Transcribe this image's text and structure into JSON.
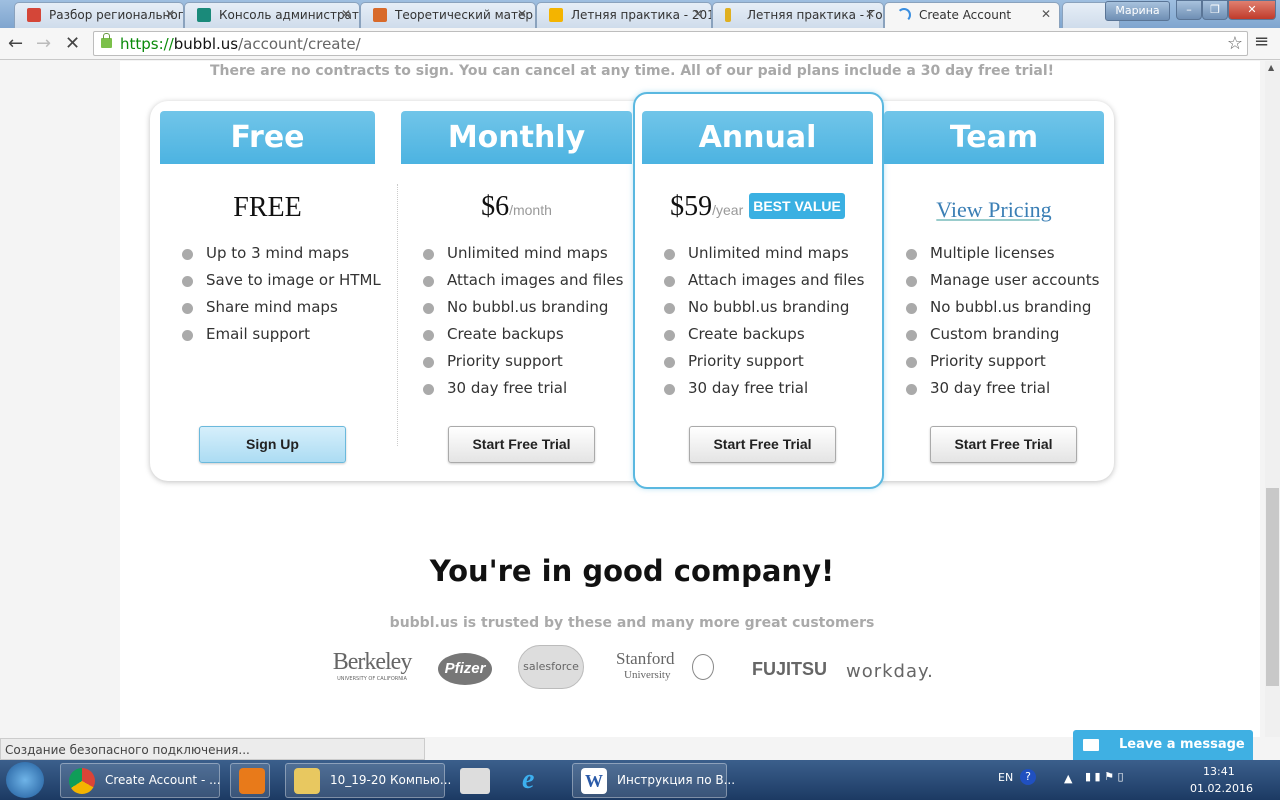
{
  "browser": {
    "tabs": [
      {
        "title": "Разбор региональног",
        "icon": "gmail-icon",
        "color": "#d44638"
      },
      {
        "title": "Консоль администрат",
        "icon": "console-icon",
        "color": "#1a8a7a"
      },
      {
        "title": "Теоретический матер",
        "icon": "owl-icon",
        "color": "#d86a2a"
      },
      {
        "title": "Летняя практика - 201",
        "icon": "google-drive-icon",
        "color": "#f4b400"
      },
      {
        "title": "Летняя практика - Гор",
        "icon": "site-icon",
        "color": "#e0b020"
      },
      {
        "title": "Create Account",
        "icon": "loading-icon",
        "color": "#3a8ee0"
      }
    ],
    "user": "Марина",
    "url_scheme": "https://",
    "url_host": "bubbl.us",
    "url_path": "/account/create/",
    "status": "Создание безопасного подключения..."
  },
  "page": {
    "top_note": "There are no contracts to sign. You can cancel at any time. All of our paid plans include a 30 day free trial!",
    "plans": [
      {
        "name": "Free",
        "price": "FREE",
        "features": [
          "Up to 3 mind maps",
          "Save to image or HTML",
          "Share mind maps",
          "Email support"
        ],
        "button": "Sign Up"
      },
      {
        "name": "Monthly",
        "price": "$6",
        "period": "/month",
        "features": [
          "Unlimited mind maps",
          "Attach images and files",
          "No bubbl.us branding",
          "Create backups",
          "Priority support",
          "30 day free trial"
        ],
        "button": "Start Free Trial"
      },
      {
        "name": "Annual",
        "price": "$59",
        "period": "/year",
        "badge": "BEST VALUE",
        "features": [
          "Unlimited mind maps",
          "Attach images and files",
          "No bubbl.us branding",
          "Create backups",
          "Priority support",
          "30 day free trial"
        ],
        "button": "Start Free Trial"
      },
      {
        "name": "Team",
        "price_link": "View Pricing",
        "features": [
          "Multiple licenses",
          "Manage user accounts",
          "No bubbl.us branding",
          "Custom branding",
          "Priority support",
          "30 day free trial"
        ],
        "button": "Start Free Trial"
      }
    ],
    "company_title": "You're in good company!",
    "trusted": "bubbl.us is trusted by these and many more great customers",
    "logos": [
      {
        "name": "Berkeley",
        "sub": "UNIVERSITY OF CALIFORNIA"
      },
      {
        "name": "Pfizer"
      },
      {
        "name": "salesforce"
      },
      {
        "name": "Stanford",
        "sub": "University"
      },
      {
        "name": "FUJITSU"
      },
      {
        "name": "workday."
      }
    ],
    "chat": "Leave a message"
  },
  "taskbar": {
    "items": [
      "Create Account - ...",
      "10_19-20 Компью...",
      "Инструкция по В..."
    ],
    "lang": "EN",
    "time": "13:41",
    "date": "01.02.2016"
  }
}
